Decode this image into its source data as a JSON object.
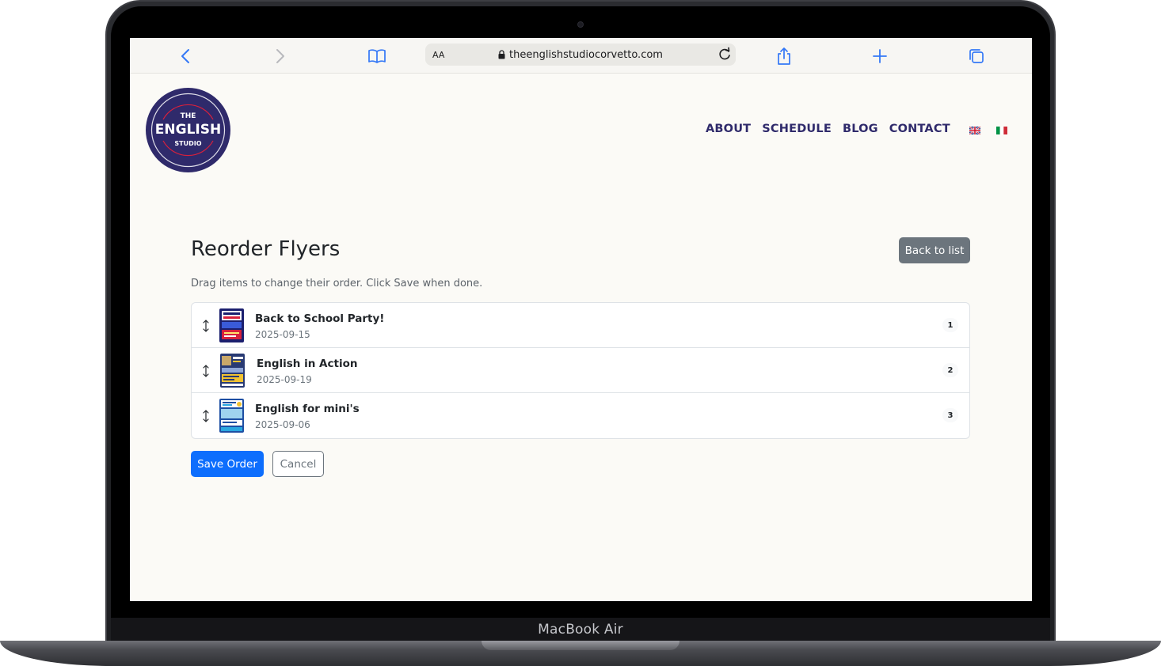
{
  "device": {
    "label": "MacBook Air"
  },
  "browser": {
    "text_size_label": "AA",
    "url": "theenglishstudiocorvetto.com"
  },
  "site": {
    "logo": {
      "top": "THE",
      "middle": "ENGLISH",
      "bottom": "STUDIO",
      "color": "#2f2a6b"
    },
    "nav": [
      "ABOUT",
      "SCHEDULE",
      "BLOG",
      "CONTACT"
    ],
    "languages": [
      "en-flag-icon",
      "it-flag-icon"
    ]
  },
  "page": {
    "title": "Reorder Flyers",
    "back_button": "Back to list",
    "help_text": "Drag items to change their order. Click Save when done.",
    "items": [
      {
        "title": "Back to School Party!",
        "date": "2025-09-15",
        "order": "1"
      },
      {
        "title": "English in Action",
        "date": "2025-09-19",
        "order": "2"
      },
      {
        "title": "English for mini's",
        "date": "2025-09-06",
        "order": "3"
      }
    ],
    "save_button": "Save Order",
    "cancel_button": "Cancel"
  },
  "colors": {
    "primary": "#0d6efd",
    "secondary": "#6c757d",
    "brand": "#2f2a6b",
    "browser_accent": "#3478f6"
  }
}
